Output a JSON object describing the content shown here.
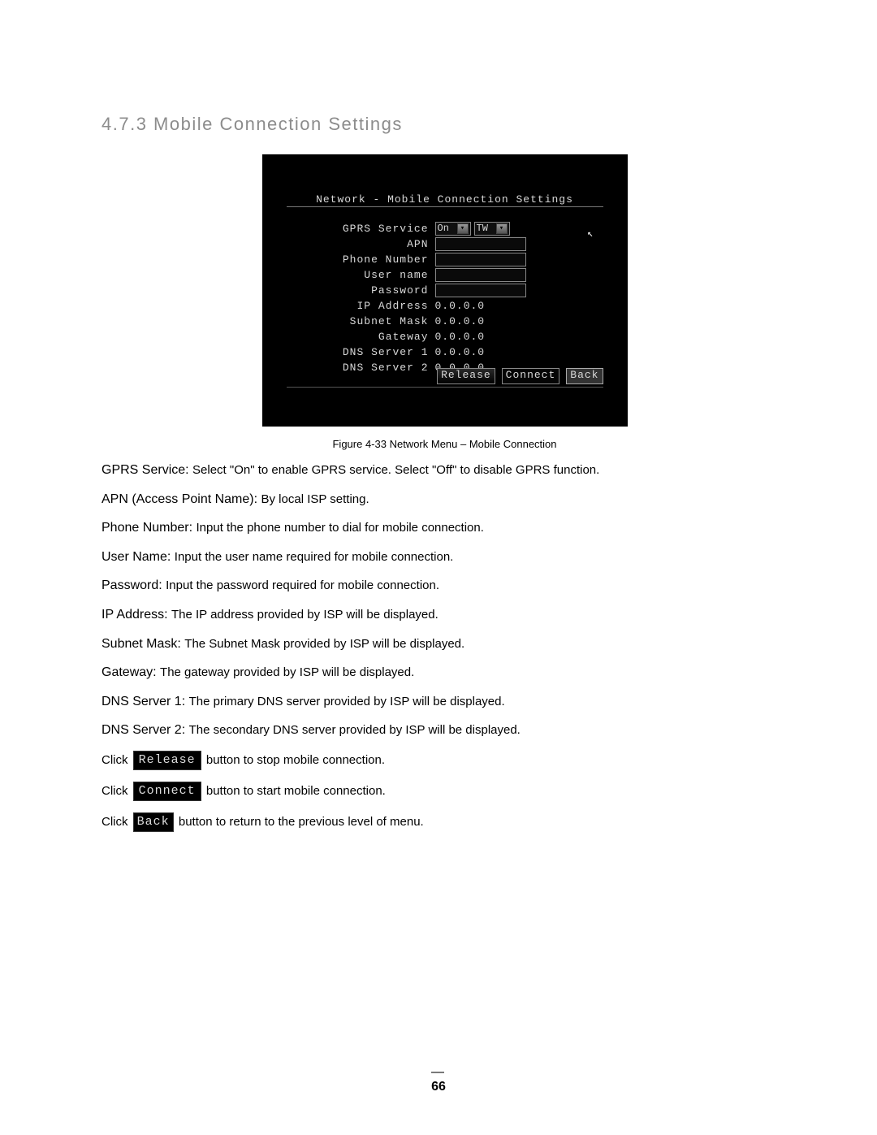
{
  "heading": "4.7.3 Mobile Connection Settings",
  "screenshot": {
    "title": "Network - Mobile Connection Settings",
    "rows": {
      "gprs_label": "GPRS Service",
      "gprs_value_on": "On",
      "gprs_value_region": "TW",
      "apn_label": "APN",
      "phone_label": "Phone Number",
      "user_label": "User name",
      "password_label": "Password",
      "ip_label": "IP Address",
      "ip_value": "0.0.0.0",
      "subnet_label": "Subnet Mask",
      "subnet_value": "0.0.0.0",
      "gateway_label": "Gateway",
      "gateway_value": "0.0.0.0",
      "dns1_label": "DNS Server 1",
      "dns1_value": "0.0.0.0",
      "dns2_label": "DNS Server 2",
      "dns2_value": "0.0.0.0"
    },
    "buttons": {
      "release": "Release",
      "connect": "Connect",
      "back": "Back"
    }
  },
  "caption": "Figure 4-33  Network Menu – Mobile Connection",
  "paragraphs": {
    "gprs_term": "GPRS Service: ",
    "gprs_desc": "Select \"On\" to enable GPRS service.  Select \"Off\" to disable GPRS function.",
    "apn_term": "APN (Access Point Name): ",
    "apn_desc": "By local ISP setting.",
    "phone_term": "Phone Number: ",
    "phone_desc": "Input the phone number to dial for mobile connection.",
    "user_term": "User Name: ",
    "user_desc": "Input the user name required for mobile connection.",
    "pw_term": "Password: ",
    "pw_desc": "Input the password required for mobile connection.",
    "ip_term": "IP Address: ",
    "ip_desc": "The IP address provided by ISP will be displayed.",
    "subnet_term": "Subnet Mask: ",
    "subnet_desc": "The Subnet Mask provided by ISP will be displayed.",
    "gateway_term": "Gateway: ",
    "gateway_desc": "The gateway provided by ISP will be displayed.",
    "dns1_term": "DNS Server 1: ",
    "dns1_desc": "The primary DNS server provided by ISP will be displayed.",
    "dns2_term": "DNS Server 2: ",
    "dns2_desc": "The secondary DNS server provided by ISP will be displayed.",
    "click_prefix": "Click ",
    "release_btn": "Release",
    "release_desc": " button to stop mobile connection.",
    "connect_btn": "Connect",
    "connect_desc": " button to start mobile connection.",
    "back_btn": "Back",
    "back_desc": " button to return to the previous level of menu."
  },
  "footer": {
    "dash": "—",
    "page": "66"
  }
}
